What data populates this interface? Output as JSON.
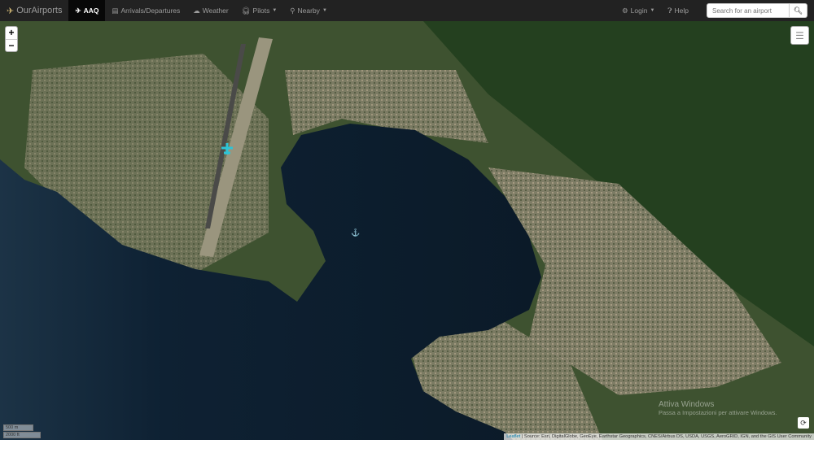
{
  "nav": {
    "brand": "OurAirports",
    "airport": "AAQ",
    "arrivals": "Arrivals/Departures",
    "weather": "Weather",
    "pilots": "Pilots",
    "nearby": "Nearby",
    "login": "Login",
    "help": "Help",
    "search_placeholder": "Search for an airport"
  },
  "map": {
    "zoom_in": "+",
    "zoom_out": "−",
    "scale_metric": "500 m",
    "scale_imperial": "2000 ft",
    "attribution_link": "Leaflet",
    "attribution_text": " | Source: Esri, DigitalGlobe, GeoEye, Earthstar Geographics, CNES/Airbus DS, USDA, USGS, AeroGRID, IGN, and the GIS User Community",
    "layer": "satellite imagery",
    "marker_color": "#2ec4d6"
  },
  "watermark": {
    "title": "Attiva Windows",
    "subtitle": "Passa a Impostazioni per attivare Windows."
  }
}
